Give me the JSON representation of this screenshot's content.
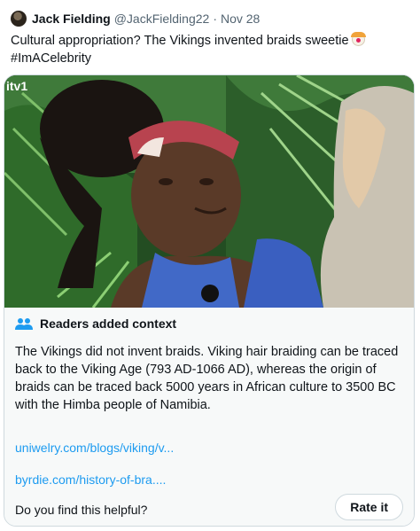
{
  "tweet": {
    "author_name": "Jack Fielding",
    "handle": "@JackFielding22",
    "separator": "·",
    "date": "Nov 28",
    "text_line1": "Cultural appropriation? The Vikings invented braids sweetie",
    "emoji_icon": "clown-face-icon",
    "hashtag": "#ImACelebrity"
  },
  "media": {
    "channel_logo": "itv1"
  },
  "community_note": {
    "heading": "Readers added context",
    "heading_icon": "people-icon",
    "body": "The Vikings did not invent braids. Viking hair braiding can be traced back to the Viking Age (793 AD-1066 AD), whereas the origin of braids can be traced back 5000 years in African culture to 3500 BC with the Himba people of Namibia.",
    "links": [
      "uniwelry.com/blogs/viking/v...",
      "byrdie.com/history-of-bra...."
    ],
    "helpful_prompt": "Do you find this helpful?",
    "rate_button": "Rate it"
  },
  "colors": {
    "link": "#1d9bf0",
    "secondary_text": "#536471",
    "note_background": "#f7f9f9",
    "border": "#cfd9de"
  }
}
